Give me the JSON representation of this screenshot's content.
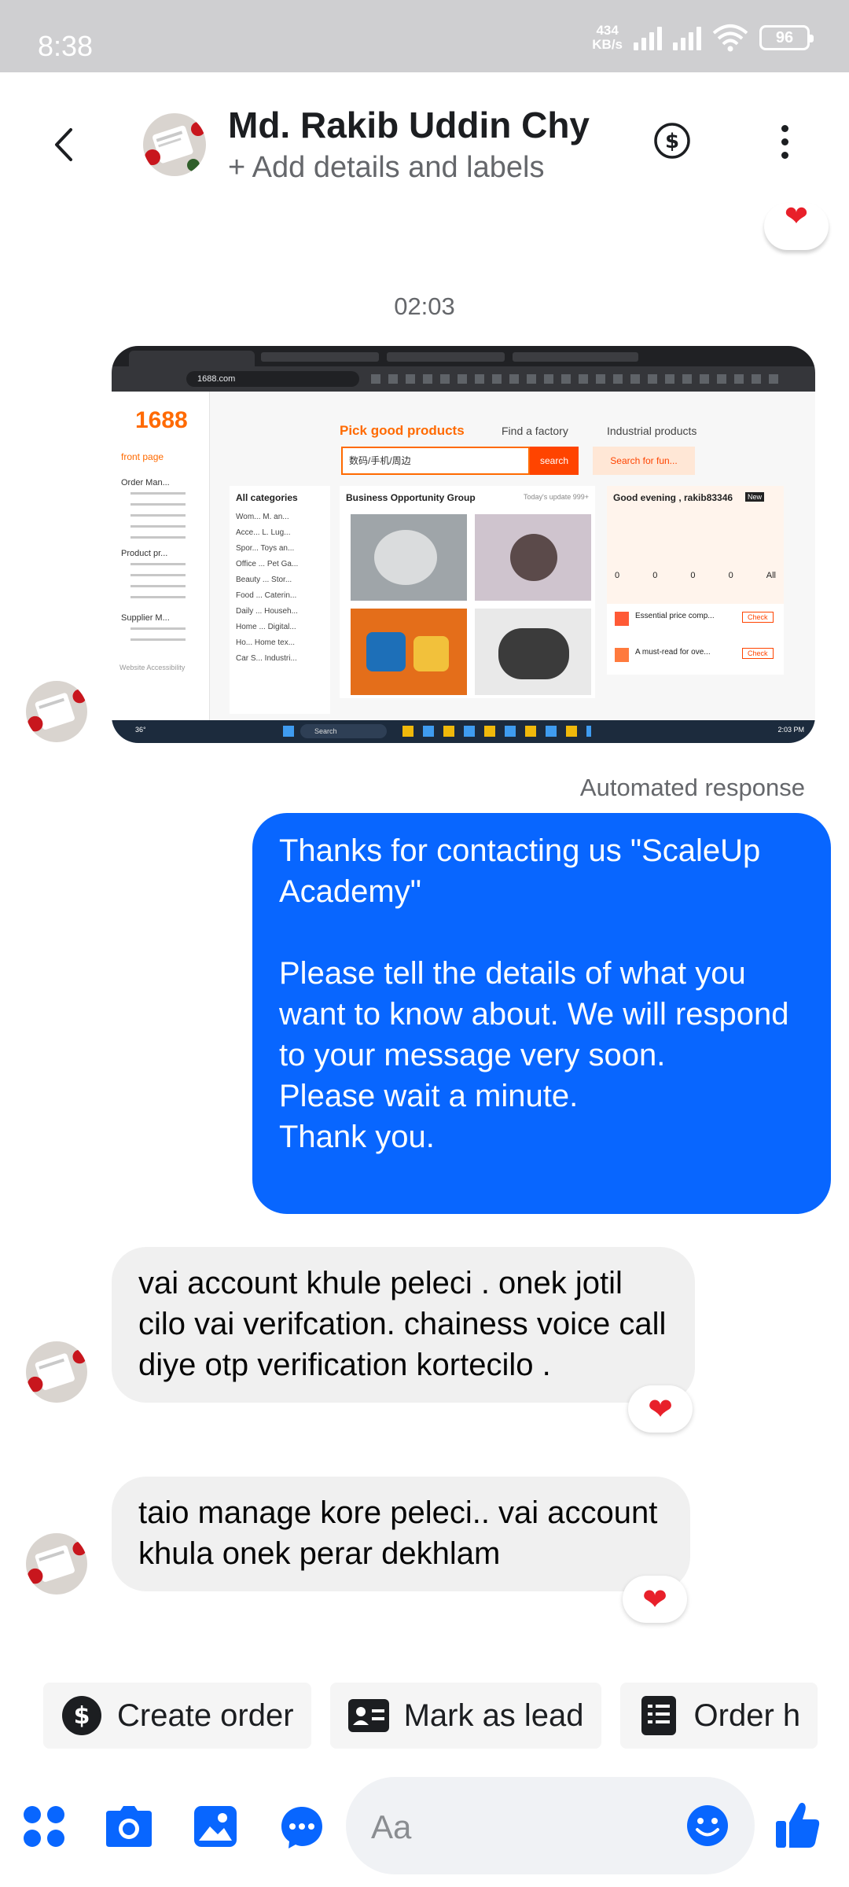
{
  "status_bar": {
    "time": "8:38",
    "net_speed": "434",
    "net_unit": "KB/s",
    "battery": "96"
  },
  "header": {
    "contact_name": "Md. Rakib Uddin Chy",
    "subtitle": "+ Add details and labels"
  },
  "chat": {
    "timestamp": "02:03",
    "automated_label": "Automated response",
    "outgoing_message": "Thanks for contacting us \"ScaleUp Academy\"\n\nPlease tell the details of what you want to know about. We will respond to your message very soon.\nPlease wait a minute.\nThank you.",
    "incoming_1": "vai account khule peleci . onek jotil cilo vai verifcation. chainess voice call diye otp verification kortecilo .",
    "incoming_2": "taio manage kore peleci.. vai account khula onek perar dekhlam",
    "reaction": "❤"
  },
  "screenshot": {
    "logo": "1688",
    "url": "1688.com",
    "nav": [
      "Pick good products",
      "Find a factory",
      "Industrial products"
    ],
    "search_text": "数码/手机/周边",
    "search_button": "search",
    "search_for_fun": "Search for fun...",
    "side_menu": [
      "front page",
      "Order Man...",
      "Product pr...",
      "Supplier M...",
      "Website Accessibility"
    ],
    "categories_title": "All categories",
    "categories": [
      "Wom... M. an...",
      "Acce... L. Lug...",
      "Spor... Toys an...",
      "Office ... Pet Ga...",
      "Beauty ... Stor...",
      "Food ... Caterin...",
      "Daily ... Househ...",
      "Home ... Digital...",
      "Ho... Home tex...",
      "Car S... Industri..."
    ],
    "biz_title": "Business Opportunity Group",
    "biz_right": "Today's update 999+",
    "greeting": "Good evening , rakib83346",
    "greeting_badge": "New",
    "stats": [
      "0",
      "0",
      "0",
      "0",
      "All"
    ],
    "promo_1": "Essential price comp...",
    "promo_2": "A must-read for ove...",
    "check": "Check",
    "taskbar_weather": "36°",
    "taskbar_search": "Search",
    "taskbar_time": "2:03 PM"
  },
  "quick_actions": [
    "Create order",
    "Mark as lead",
    "Order h"
  ],
  "composer": {
    "placeholder": "Aa"
  },
  "colors": {
    "messenger_blue": "#0866ff",
    "status_bar": "#cfcfd1",
    "incoming_bubble": "#f0f0f0",
    "reaction_red": "#e8202a",
    "orange_1688": "#ff6a00"
  }
}
